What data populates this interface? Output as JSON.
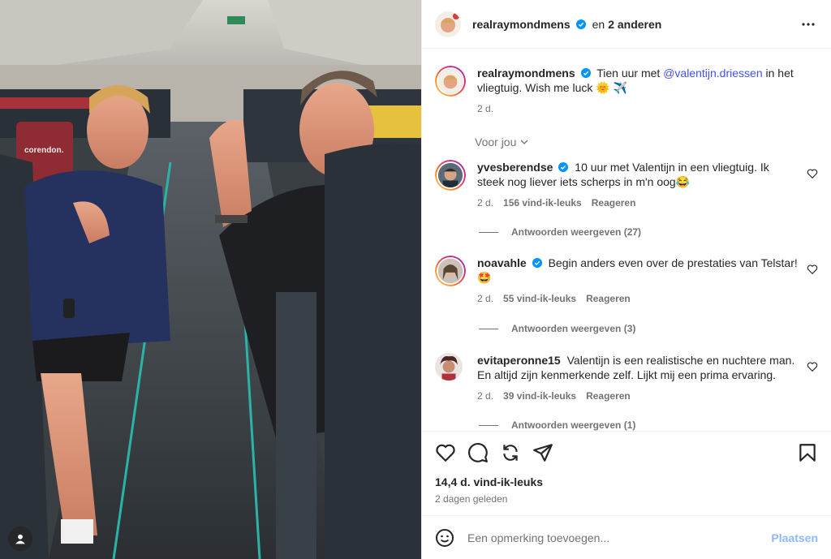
{
  "post": {
    "author": "realraymondmens",
    "coauthors_prefix": "en",
    "coauthors": "2 anderen",
    "caption_author": "realraymondmens",
    "caption_text_1": "Tien uur met",
    "caption_mention": "@valentijn.driessen",
    "caption_text_2": "in het vliegtuig. Wish me luck 🌞 ✈️",
    "caption_time": "2 d.",
    "filter_label": "Voor jou",
    "likes": "14,4 d. vind-ik-leuks",
    "posted": "2 dagen geleden"
  },
  "comments": [
    {
      "user": "yvesberendse",
      "verified": true,
      "text": "10 uur met Valentijn in een vliegtuig. Ik steek nog liever iets scherps in m'n oog😂",
      "time": "2 d.",
      "likes": "156 vind-ik-leuks",
      "reply": "Reageren",
      "replies": "Antwoorden weergeven (27)"
    },
    {
      "user": "noavahle",
      "verified": true,
      "text": "Begin anders even over de prestaties van Telstar! 🤩",
      "time": "2 d.",
      "likes": "55 vind-ik-leuks",
      "reply": "Reageren",
      "replies": "Antwoorden weergeven (3)"
    },
    {
      "user": "evitaperonne15",
      "verified": false,
      "text": "Valentijn is een realistische en nuchtere man. En altijd zijn kenmerkende zelf. Lijkt mij een prima ervaring.",
      "time": "2 d.",
      "likes": "39 vind-ik-leuks",
      "reply": "Reageren",
      "replies": "Antwoorden weergeven (1)"
    }
  ],
  "composer": {
    "placeholder": "Een opmerking toevoegen...",
    "submit": "Plaatsen"
  },
  "photo": {
    "seat_brand": "corendon."
  },
  "icons": [
    "more-icon",
    "verified-icon",
    "heart-icon",
    "comment-icon",
    "share-icon",
    "send-icon",
    "save-icon",
    "emoji-icon",
    "user-tag-icon",
    "chevron-down-icon"
  ],
  "colors": {
    "verified": "#0095f6",
    "mention": "#4150f7",
    "post_button": "#8fb9f7"
  }
}
